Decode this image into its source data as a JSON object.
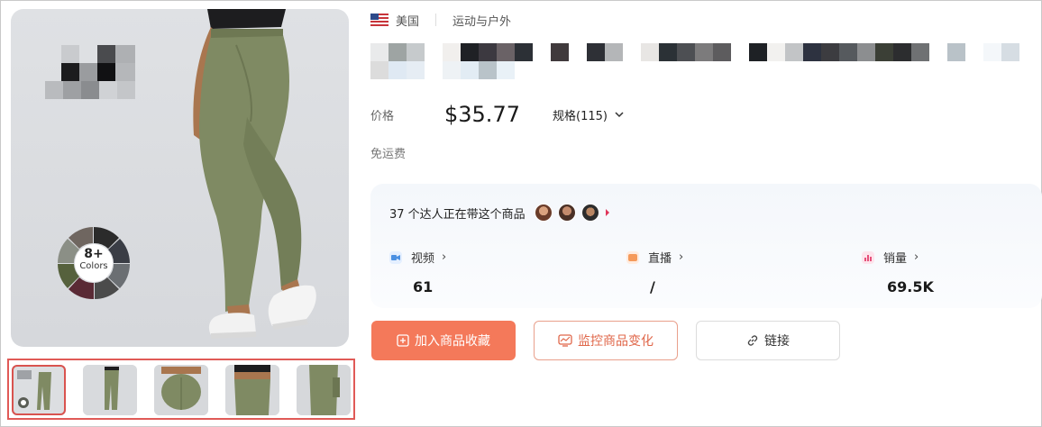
{
  "region": {
    "country": "美国",
    "category": "运动与户外"
  },
  "gallery": {
    "badge_count": "8+",
    "badge_label": "Colors"
  },
  "price": {
    "label": "价格",
    "value": "$35.77",
    "spec": "规格(115)"
  },
  "shipping": "免运费",
  "stats": {
    "creators_text": "37 个达人正在带这个商品",
    "video": {
      "label": "视频",
      "value": "61"
    },
    "live": {
      "label": "直播",
      "value": "/"
    },
    "sales": {
      "label": "销量",
      "value": "69.5K"
    }
  },
  "actions": {
    "favorite": "加入商品收藏",
    "monitor": "监控商品变化",
    "link": "链接"
  },
  "colors": {
    "accent": "#f4795a",
    "accent_border": "#e9a08c",
    "thumb_highlight": "#e05a57",
    "video_icon": "#4a90e2",
    "live_icon": "#f59a5b",
    "sales_icon": "#e6507a"
  },
  "icons": {
    "flag": "us-flag-icon",
    "spec_chevron": "chevron-down-icon",
    "video": "video-icon",
    "live": "live-icon",
    "sales": "sales-icon",
    "favorite": "bookmark-plus-icon",
    "monitor": "monitor-icon",
    "link": "link-icon"
  }
}
